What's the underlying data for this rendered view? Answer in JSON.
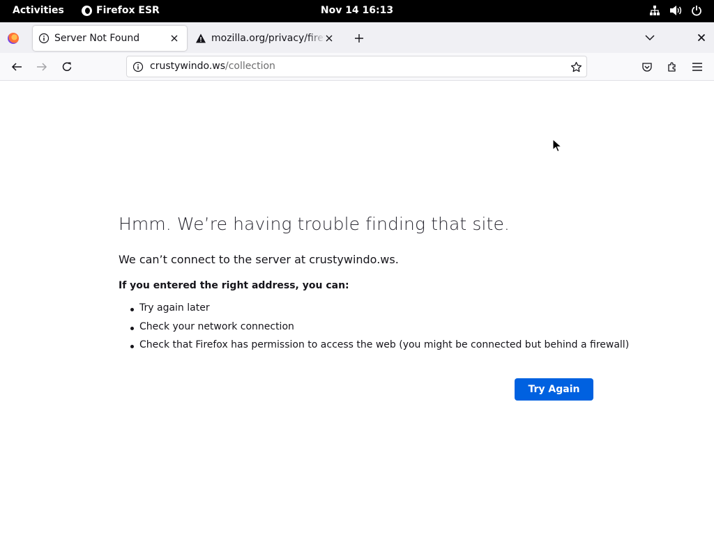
{
  "topbar": {
    "activities": "Activities",
    "app_name": "Firefox ESR",
    "clock": "Nov 14  16:13",
    "icons": [
      "network-icon",
      "volume-icon",
      "power-icon"
    ]
  },
  "tabs": [
    {
      "title": "Server Not Found",
      "icon": "info-icon",
      "active": true
    },
    {
      "title": "mozilla.org/privacy/firefox",
      "icon": "warning-icon",
      "active": false
    }
  ],
  "toolbar": {
    "url_host": "crustywindo.ws",
    "url_path": "/collection"
  },
  "error": {
    "title": "Hmm. We’re having trouble finding that site.",
    "description": "We can’t connect to the server at crustywindo.ws.",
    "subheading": "If you entered the right address, you can:",
    "suggestions": [
      "Try again later",
      "Check your network connection",
      "Check that Firefox has permission to access the web (you might be connected but behind a firewall)"
    ],
    "button_label": "Try Again"
  },
  "colors": {
    "accent": "#0061e0",
    "topbar": "#000000",
    "tabstrip": "#f0f0f4"
  }
}
